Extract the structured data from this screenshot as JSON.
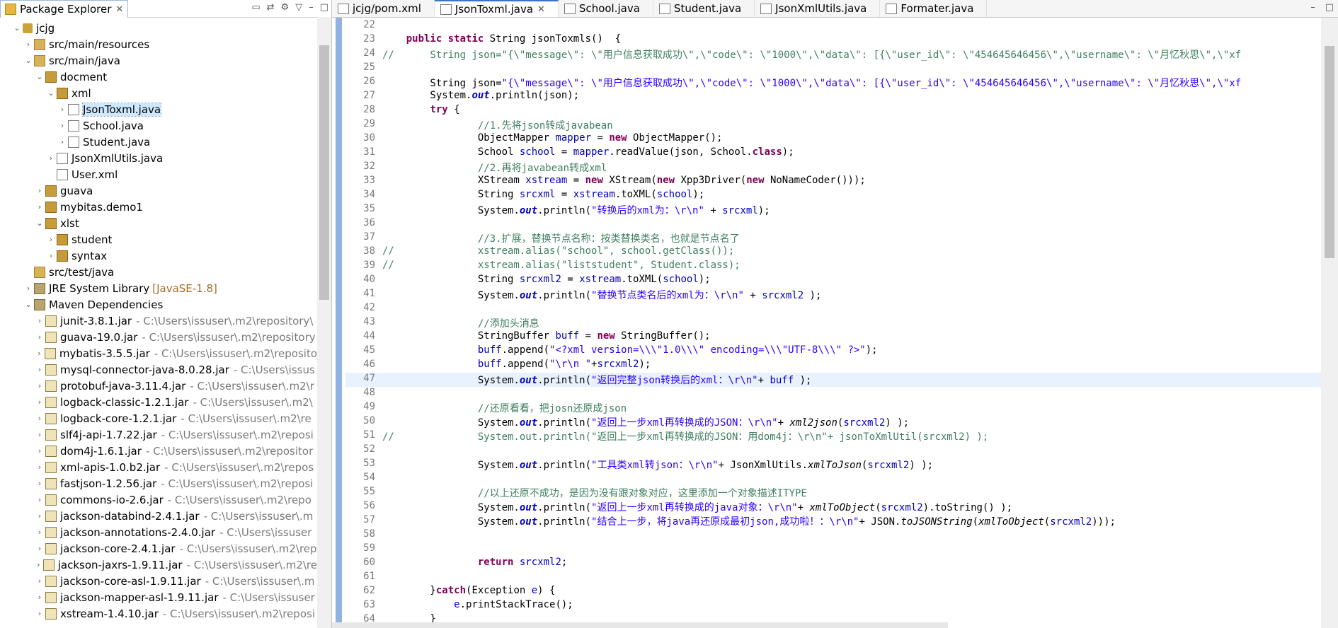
{
  "package_explorer": {
    "title": "Package Explorer",
    "close_label": "✕",
    "tree": [
      {
        "depth": 0,
        "arrow": "down",
        "icon": "project-icon",
        "label": "jcjg"
      },
      {
        "depth": 1,
        "arrow": "right",
        "icon": "source-folder-icon",
        "label": "src/main/resources"
      },
      {
        "depth": 1,
        "arrow": "down",
        "icon": "source-folder-icon",
        "label": "src/main/java"
      },
      {
        "depth": 2,
        "arrow": "down",
        "icon": "package-icon",
        "label": "docment"
      },
      {
        "depth": 3,
        "arrow": "down",
        "icon": "package-icon",
        "label": "xml"
      },
      {
        "depth": 4,
        "arrow": "right",
        "icon": "java-file-icon",
        "label": "JsonToxml.java",
        "selected": true
      },
      {
        "depth": 4,
        "arrow": "right",
        "icon": "java-file-icon",
        "label": "School.java"
      },
      {
        "depth": 4,
        "arrow": "right",
        "icon": "java-file-icon",
        "label": "Student.java"
      },
      {
        "depth": 3,
        "arrow": "right",
        "icon": "java-file-icon",
        "label": "JsonXmlUtils.java"
      },
      {
        "depth": 3,
        "arrow": "",
        "icon": "xml-file-icon",
        "label": "User.xml"
      },
      {
        "depth": 2,
        "arrow": "right",
        "icon": "package-icon",
        "label": "guava"
      },
      {
        "depth": 2,
        "arrow": "right",
        "icon": "package-icon",
        "label": "mybitas.demo1"
      },
      {
        "depth": 2,
        "arrow": "down",
        "icon": "package-icon",
        "label": "xlst"
      },
      {
        "depth": 3,
        "arrow": "right",
        "icon": "package-icon",
        "label": "student"
      },
      {
        "depth": 3,
        "arrow": "right",
        "icon": "package-icon",
        "label": "syntax"
      },
      {
        "depth": 1,
        "arrow": "",
        "icon": "source-folder-icon",
        "label": "src/test/java"
      },
      {
        "depth": 1,
        "arrow": "right",
        "icon": "library-icon",
        "label": "JRE System Library",
        "extra": "[JavaSE-1.8]"
      },
      {
        "depth": 1,
        "arrow": "down",
        "icon": "library-icon",
        "label": "Maven Dependencies"
      },
      {
        "depth": 2,
        "arrow": "right",
        "icon": "jar-icon",
        "label": "junit-3.8.1.jar",
        "path": "- C:\\Users\\issuser\\.m2\\repository\\"
      },
      {
        "depth": 2,
        "arrow": "right",
        "icon": "jar-icon",
        "label": "guava-19.0.jar",
        "path": "- C:\\Users\\issuser\\.m2\\repository"
      },
      {
        "depth": 2,
        "arrow": "right",
        "icon": "jar-icon",
        "label": "mybatis-3.5.5.jar",
        "path": "- C:\\Users\\issuser\\.m2\\reposito"
      },
      {
        "depth": 2,
        "arrow": "right",
        "icon": "jar-icon",
        "label": "mysql-connector-java-8.0.28.jar",
        "path": "- C:\\Users\\issus"
      },
      {
        "depth": 2,
        "arrow": "right",
        "icon": "jar-icon",
        "label": "protobuf-java-3.11.4.jar",
        "path": "- C:\\Users\\issuser\\.m2\\r"
      },
      {
        "depth": 2,
        "arrow": "right",
        "icon": "jar-icon",
        "label": "logback-classic-1.2.1.jar",
        "path": "- C:\\Users\\issuser\\.m2\\"
      },
      {
        "depth": 2,
        "arrow": "right",
        "icon": "jar-icon",
        "label": "logback-core-1.2.1.jar",
        "path": "- C:\\Users\\issuser\\.m2\\re"
      },
      {
        "depth": 2,
        "arrow": "right",
        "icon": "jar-icon",
        "label": "slf4j-api-1.7.22.jar",
        "path": "- C:\\Users\\issuser\\.m2\\reposi"
      },
      {
        "depth": 2,
        "arrow": "right",
        "icon": "jar-icon",
        "label": "dom4j-1.6.1.jar",
        "path": "- C:\\Users\\issuser\\.m2\\repositor"
      },
      {
        "depth": 2,
        "arrow": "right",
        "icon": "jar-icon",
        "label": "xml-apis-1.0.b2.jar",
        "path": "- C:\\Users\\issuser\\.m2\\repos"
      },
      {
        "depth": 2,
        "arrow": "right",
        "icon": "jar-icon",
        "label": "fastjson-1.2.56.jar",
        "path": "- C:\\Users\\issuser\\.m2\\reposi"
      },
      {
        "depth": 2,
        "arrow": "right",
        "icon": "jar-icon",
        "label": "commons-io-2.6.jar",
        "path": "- C:\\Users\\issuser\\.m2\\repo"
      },
      {
        "depth": 2,
        "arrow": "right",
        "icon": "jar-icon",
        "label": "jackson-databind-2.4.1.jar",
        "path": "- C:\\Users\\issuser\\.m"
      },
      {
        "depth": 2,
        "arrow": "right",
        "icon": "jar-icon",
        "label": "jackson-annotations-2.4.0.jar",
        "path": "- C:\\Users\\issuser"
      },
      {
        "depth": 2,
        "arrow": "right",
        "icon": "jar-icon",
        "label": "jackson-core-2.4.1.jar",
        "path": "- C:\\Users\\issuser\\.m2\\rep"
      },
      {
        "depth": 2,
        "arrow": "right",
        "icon": "jar-icon",
        "label": "jackson-jaxrs-1.9.11.jar",
        "path": "- C:\\Users\\issuser\\.m2\\re"
      },
      {
        "depth": 2,
        "arrow": "right",
        "icon": "jar-icon",
        "label": "jackson-core-asl-1.9.11.jar",
        "path": "- C:\\Users\\issuser\\.m"
      },
      {
        "depth": 2,
        "arrow": "right",
        "icon": "jar-icon",
        "label": "jackson-mapper-asl-1.9.11.jar",
        "path": "- C:\\Users\\issuser"
      },
      {
        "depth": 2,
        "arrow": "right",
        "icon": "jar-icon",
        "label": "xstream-1.4.10.jar",
        "path": "- C:\\Users\\issuser\\.m2\\reposi"
      }
    ]
  },
  "editor": {
    "tabs": [
      {
        "label": "jcjg/pom.xml",
        "active": false,
        "icon": "xml-file-icon"
      },
      {
        "label": "JsonToxml.java",
        "active": true,
        "icon": "java-file-icon",
        "close": "✕"
      },
      {
        "label": "School.java",
        "active": false,
        "icon": "java-file-icon"
      },
      {
        "label": "Student.java",
        "active": false,
        "icon": "java-file-icon"
      },
      {
        "label": "JsonXmlUtils.java",
        "active": false,
        "icon": "java-file-icon"
      },
      {
        "label": "Formater.java",
        "active": false,
        "icon": "java-file-icon"
      }
    ],
    "highlighted_line": 47,
    "lines": [
      {
        "n": "22",
        "t": ""
      },
      {
        "n": "23",
        "t": "    public static String jsonToxmls()  {"
      },
      {
        "n": "24",
        "t": "//      String json=\"{\\\"message\\\": \\\"用户信息获取成功\\\",\\\"code\\\": \\\"1000\\\",\\\"data\\\": [{\\\"user_id\\\": \\\"454645646456\\\",\\\"username\\\": \\\"月忆秋思\\\",\\\"xf"
      },
      {
        "n": "25",
        "t": ""
      },
      {
        "n": "26",
        "t": "        String json=\"{\\\"message\\\": \\\"用户信息获取成功\\\",\\\"code\\\": \\\"1000\\\",\\\"data\\\": [{\\\"user_id\\\": \\\"454645646456\\\",\\\"username\\\": \\\"月忆秋思\\\",\\\"xf"
      },
      {
        "n": "27",
        "t": "        System.out.println(json);"
      },
      {
        "n": "28",
        "t": "        try {"
      },
      {
        "n": "29",
        "t": "                //1.先将json转成javabean"
      },
      {
        "n": "30",
        "t": "                ObjectMapper mapper = new ObjectMapper();"
      },
      {
        "n": "31",
        "t": "                School school = mapper.readValue(json, School.class);"
      },
      {
        "n": "32",
        "t": "                //2.再将javabean转成xml"
      },
      {
        "n": "33",
        "t": "                XStream xstream = new XStream(new Xpp3Driver(new NoNameCoder()));"
      },
      {
        "n": "34",
        "t": "                String srcxml = xstream.toXML(school);"
      },
      {
        "n": "35",
        "t": "                System.out.println(\"转换后的xml为：\\r\\n\" + srcxml);"
      },
      {
        "n": "36",
        "t": ""
      },
      {
        "n": "37",
        "t": "                //3.扩展，替换节点名称：按类替换类名，也就是节点名了"
      },
      {
        "n": "38",
        "t": "//              xstream.alias(\"school\", school.getClass());"
      },
      {
        "n": "39",
        "t": "//              xstream.alias(\"liststudent\", Student.class);"
      },
      {
        "n": "40",
        "t": "                String srcxml2 = xstream.toXML(school);"
      },
      {
        "n": "41",
        "t": "                System.out.println(\"替换节点类名后的xml为：\\r\\n\" + srcxml2 );"
      },
      {
        "n": "42",
        "t": ""
      },
      {
        "n": "43",
        "t": "                //添加头消息"
      },
      {
        "n": "44",
        "t": "                StringBuffer buff = new StringBuffer();"
      },
      {
        "n": "45",
        "t": "                buff.append(\"<?xml version=\\\\\\\"1.0\\\\\\\" encoding=\\\\\\\"UTF-8\\\\\\\" ?>\");"
      },
      {
        "n": "46",
        "t": "                buff.append(\"\\r\\n \"+srcxml2);"
      },
      {
        "n": "47",
        "t": "                System.out.println(\"返回完整json转换后的xml：\\r\\n\"+ buff );"
      },
      {
        "n": "48",
        "t": ""
      },
      {
        "n": "49",
        "t": "                //还原看看，把josn还原成json"
      },
      {
        "n": "50",
        "t": "                System.out.println(\"返回上一步xml再转换成的JSON：\\r\\n\"+ xml2json(srcxml2) );"
      },
      {
        "n": "51",
        "t": "//              System.out.println(\"返回上一步xml再转换成的JSON：用dom4j：\\r\\n\"+ jsonToXmlUtil(srcxml2) );"
      },
      {
        "n": "52",
        "t": ""
      },
      {
        "n": "53",
        "t": "                System.out.println(\"工具类xml转json：\\r\\n\"+ JsonXmlUtils.xmlToJson(srcxml2) );"
      },
      {
        "n": "54",
        "t": ""
      },
      {
        "n": "55",
        "t": "                //以上还原不成功，是因为没有跟对象对应，这里添加一个对象描述ITYPE"
      },
      {
        "n": "56",
        "t": "                System.out.println(\"返回上一步xml再转换成的java对象：\\r\\n\"+ xmlToObject(srcxml2).toString() );"
      },
      {
        "n": "57",
        "t": "                System.out.println(\"结合上一步，将java再还原成最初json,成功啦！：\\r\\n\"+ JSON.toJSONString(xmlToObject(srcxml2)));"
      },
      {
        "n": "58",
        "t": ""
      },
      {
        "n": "59",
        "t": ""
      },
      {
        "n": "60",
        "t": "                return srcxml2;"
      },
      {
        "n": "61",
        "t": ""
      },
      {
        "n": "62",
        "t": "        }catch(Exception e) {"
      },
      {
        "n": "63",
        "t": "            e.printStackTrace();"
      },
      {
        "n": "64",
        "t": "        }"
      }
    ]
  }
}
